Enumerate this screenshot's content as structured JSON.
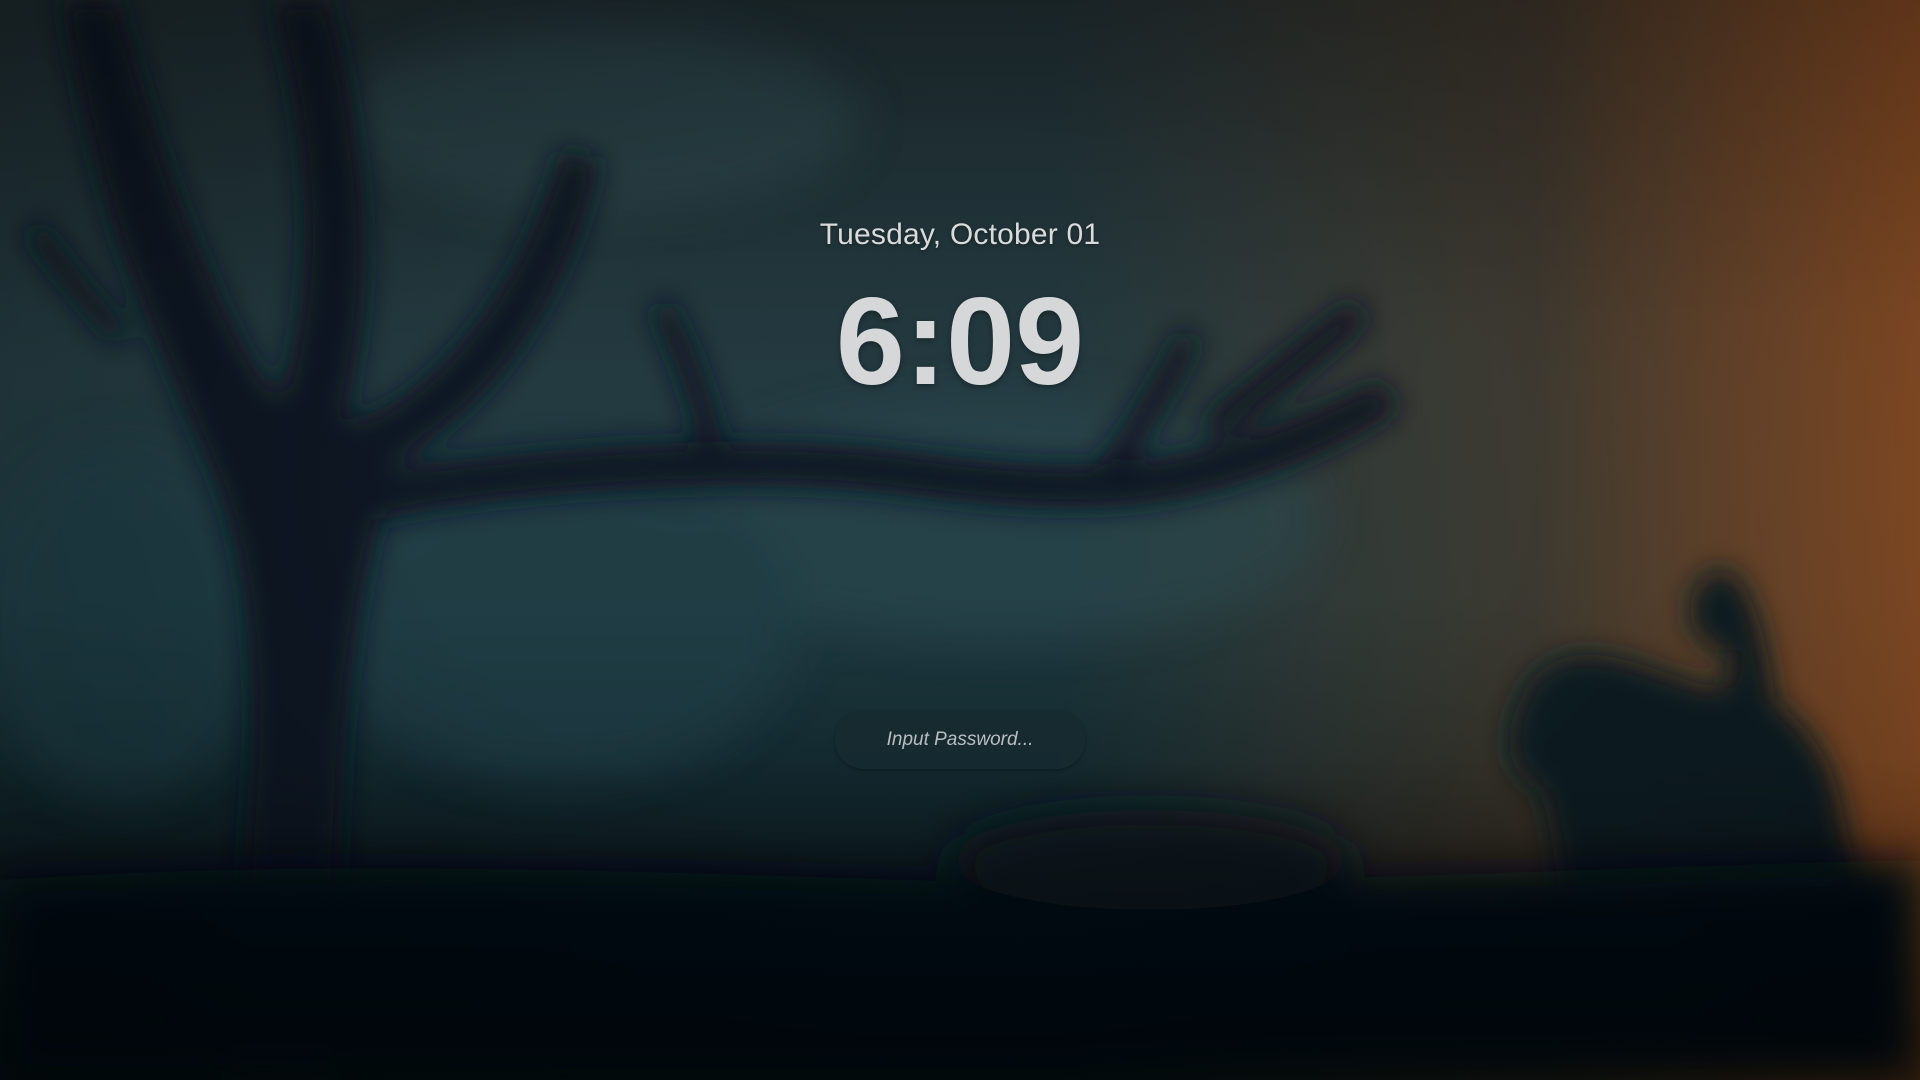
{
  "lock_screen": {
    "date": "Tuesday, October 01",
    "time": "6:09",
    "password": {
      "value": "",
      "placeholder": "Input Password..."
    }
  },
  "wallpaper": {
    "subject": "silhouette-tree-and-horse-rider-at-dusk",
    "colors": {
      "sky_dark": "#1e2c30",
      "sky_teal": "#233a40",
      "sunset_orange": "#a05422",
      "ground": "#061018",
      "silhouette": "#0a161c"
    }
  },
  "colors": {
    "text": "#d5d7d8",
    "input_background": "#162a30"
  }
}
